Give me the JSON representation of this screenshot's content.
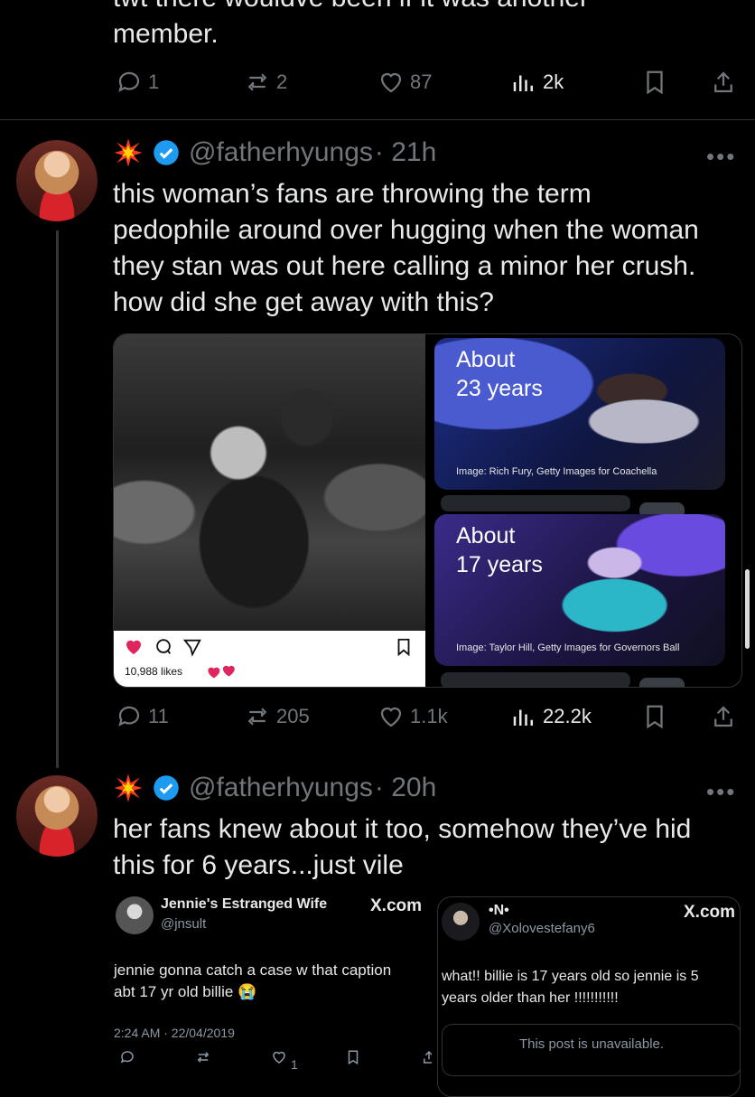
{
  "top_tweet": {
    "text_line1": "twt there wouldve been if it was another",
    "text_line2": "member.",
    "replies": "1",
    "reposts": "2",
    "likes": "87",
    "views": "2k"
  },
  "tweet1": {
    "handle": "@fatherhyungs",
    "time": "· 21h",
    "more": "•••",
    "text": [
      "this woman’s fans are throwing the term",
      "pedophile around over hugging when the woman",
      "they stan was out here calling a minor her crush.",
      "how did she get away with this?"
    ],
    "media": {
      "insta_likes": "10,988 likes",
      "card1_label": [
        "About",
        "23 years"
      ],
      "card1_credit": "Image: Rich Fury, Getty Images for Coachella",
      "card2_label": [
        "About",
        "17 years"
      ],
      "card2_credit": "Image: Taylor Hill, Getty Images for Governors Ball"
    },
    "replies": "11",
    "reposts": "205",
    "likes": "1.1k",
    "views": "22.2k"
  },
  "tweet2": {
    "handle": "@fatherhyungs",
    "time": "· 20h",
    "more": "•••",
    "text": [
      "her fans knew about it too, somehow they’ve hid",
      "this for 6 years...just vile"
    ]
  },
  "embed_left": {
    "name": "Jennie's Estranged Wife",
    "handle": "@jnsult",
    "site": "X.com",
    "text": [
      "jennie gonna catch a case w that caption",
      "abt 17 yr old billie 😭"
    ],
    "date": "2:24 AM · 22/04/2019",
    "likes": "1"
  },
  "embed_right": {
    "name": "•N•",
    "handle": "@Xolovestefany6",
    "site": "X.com",
    "text": [
      "what!! billie is 17 years old so jennie is 5",
      "years older than her !!!!!!!!!!!"
    ],
    "unavailable": "This post is unavailable."
  },
  "colors": {
    "verified": "#1d9bf0",
    "burst": "#ff3b1f",
    "muted": "#71767b",
    "heart": "#e0245e"
  }
}
